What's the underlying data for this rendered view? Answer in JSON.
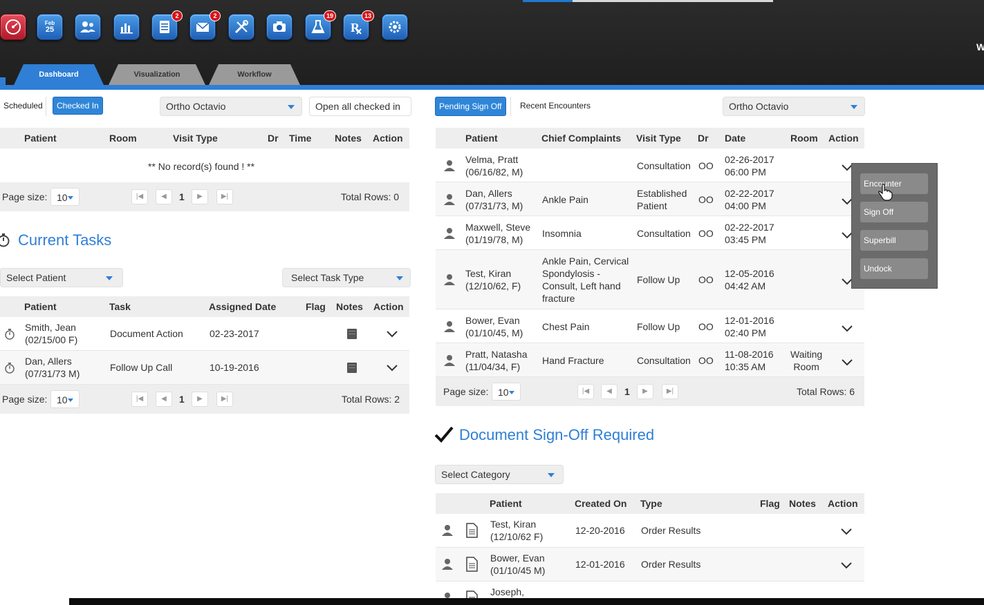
{
  "toolbar": {
    "icons": [
      {
        "name": "dashboard-gauge-icon",
        "badge": ""
      },
      {
        "name": "calendar-icon",
        "badge": "",
        "text": "25"
      },
      {
        "name": "patients-icon",
        "badge": ""
      },
      {
        "name": "reports-chart-icon",
        "badge": ""
      },
      {
        "name": "tasks-list-icon",
        "badge": "2"
      },
      {
        "name": "messages-mail-icon",
        "badge": "2"
      },
      {
        "name": "tools-icon",
        "badge": ""
      },
      {
        "name": "camera-icon",
        "badge": ""
      },
      {
        "name": "lab-flask-icon",
        "badge": "19"
      },
      {
        "name": "prescription-rx-icon",
        "badge": "13"
      },
      {
        "name": "settings-gear-icon",
        "badge": ""
      }
    ],
    "edge_char": "W"
  },
  "tabs": [
    "Dashboard",
    "Visualization",
    "Workflow"
  ],
  "left": {
    "filters": {
      "scheduled": "Scheduled",
      "checked_in": "Checked In",
      "provider": "Ortho Octavio",
      "open_all": "Open all checked in"
    },
    "appointments": {
      "headers": [
        "Patient",
        "Room",
        "Visit Type",
        "Dr",
        "Time",
        "Notes",
        "Action"
      ],
      "empty": "** No record(s) found ! **",
      "page_size_label": "Page size:",
      "page_size": "10",
      "page": "1",
      "total": "Total Rows: 0"
    },
    "tasks": {
      "title": "Current Tasks",
      "select_patient": "Select Patient",
      "select_task_type": "Select Task Type",
      "headers": [
        "Patient",
        "Task",
        "Assigned Date",
        "Flag",
        "Notes",
        "Action"
      ],
      "rows": [
        {
          "name": "Smith, Jean",
          "dob": "(02/15/00 F)",
          "task": "Document Action",
          "date": "02-23-2017"
        },
        {
          "name": "Dan, Allers",
          "dob": "(07/31/73 M)",
          "task": "Follow Up Call",
          "date": "10-19-2016"
        }
      ],
      "page_size_label": "Page size:",
      "page_size": "10",
      "page": "1",
      "total": "Total Rows: 2"
    }
  },
  "right": {
    "filters": {
      "pending": "Pending Sign Off",
      "recent": "Recent Encounters",
      "provider": "Ortho Octavio"
    },
    "encounters": {
      "headers": [
        "Patient",
        "Chief Complaints",
        "Visit Type",
        "Dr",
        "Date",
        "Room",
        "Action"
      ],
      "rows": [
        {
          "name": "Velma, Pratt",
          "dob": "(06/16/82, M)",
          "complaint": [],
          "visit": [
            "Consultation"
          ],
          "dr": "OO",
          "date": "02-26-2017",
          "time": "06:00 PM",
          "room": []
        },
        {
          "name": "Dan, Allers",
          "dob": "(07/31/73, M)",
          "complaint": [
            "Ankle Pain"
          ],
          "visit": [
            "Established",
            "Patient"
          ],
          "dr": "OO",
          "date": "02-22-2017",
          "time": "04:00 PM",
          "room": []
        },
        {
          "name": "Maxwell, Steve",
          "dob": "(01/19/78, M)",
          "complaint": [
            "Insomnia"
          ],
          "visit": [
            "Consultation"
          ],
          "dr": "OO",
          "date": "02-22-2017",
          "time": "03:45 PM",
          "room": []
        },
        {
          "name": "Test, Kiran",
          "dob": "(12/10/62, F)",
          "complaint": [
            "Ankle Pain, Cervical",
            "Spondylosis -",
            "Consult, Left hand",
            "fracture"
          ],
          "visit": [
            "Follow Up"
          ],
          "dr": "OO",
          "date": "12-05-2016",
          "time": "04:42 AM",
          "room": []
        },
        {
          "name": "Bower, Evan",
          "dob": "(01/10/45, M)",
          "complaint": [
            "Chest Pain"
          ],
          "visit": [
            "Follow Up"
          ],
          "dr": "OO",
          "date": "12-01-2016",
          "time": "02:40 PM",
          "room": []
        },
        {
          "name": "Pratt, Natasha",
          "dob": "(11/04/34, F)",
          "complaint": [
            "Hand Fracture"
          ],
          "visit": [
            "Consultation"
          ],
          "dr": "OO",
          "date": "11-08-2016",
          "time": "10:35 AM",
          "room": [
            "Waiting",
            "Room"
          ]
        }
      ],
      "page_size_label": "Page size:",
      "page_size": "10",
      "page": "1",
      "total": "Total Rows: 6"
    },
    "action_menu": [
      "Encounter",
      "Sign Off",
      "Superbill",
      "Undock"
    ],
    "docs": {
      "title": "Document Sign-Off Required",
      "select_category": "Select Category",
      "headers": [
        "Patient",
        "Created On",
        "Type",
        "Flag",
        "Notes",
        "Action"
      ],
      "rows": [
        {
          "name": "Test, Kiran",
          "dob": "(12/10/62 F)",
          "created": "12-20-2016",
          "type": "Order Results"
        },
        {
          "name": "Bower, Evan",
          "dob": "(01/10/45 M)",
          "created": "12-01-2016",
          "type": "Order Results"
        },
        {
          "name": "Joseph,",
          "dob": "",
          "created": "",
          "type": ""
        }
      ]
    }
  }
}
